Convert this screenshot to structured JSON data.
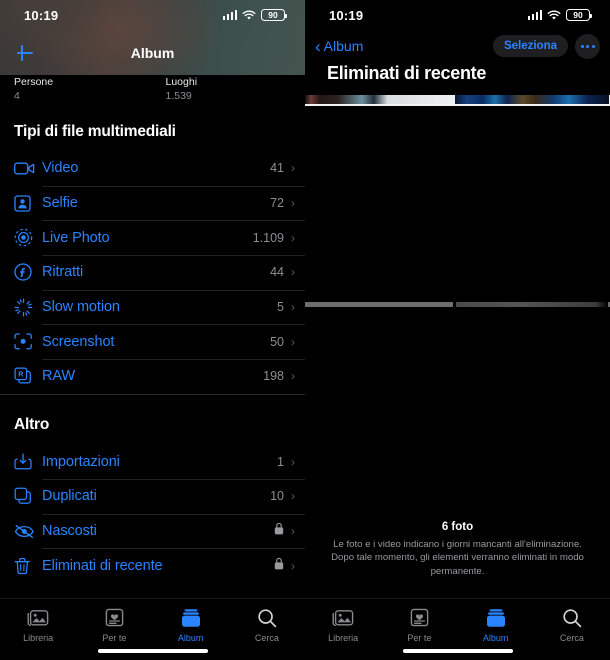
{
  "status_bar": {
    "time": "10:19",
    "battery": "90",
    "signal_icon": "cellular-bars-icon",
    "wifi_icon": "wifi-icon",
    "battery_icon": "battery-icon"
  },
  "left": {
    "nav": {
      "add_icon": "plus-icon",
      "title": "Album"
    },
    "quick": [
      {
        "name": "Persone",
        "count": "4"
      },
      {
        "name": "Luoghi",
        "count": "1.539"
      }
    ],
    "sections": [
      {
        "title": "Tipi di file multimediali",
        "rows": [
          {
            "icon": "video-camera-icon",
            "label": "Video",
            "count": "41",
            "chevron": "›"
          },
          {
            "icon": "person-portrait-icon",
            "label": "Selfie",
            "count": "72",
            "chevron": "›"
          },
          {
            "icon": "live-photo-icon",
            "label": "Live Photo",
            "count": "1.109",
            "chevron": "›"
          },
          {
            "icon": "portrait-f-icon",
            "label": "Ritratti",
            "count": "44",
            "chevron": "›"
          },
          {
            "icon": "slow-motion-icon",
            "label": "Slow motion",
            "count": "5",
            "chevron": "›"
          },
          {
            "icon": "screenshot-icon",
            "label": "Screenshot",
            "count": "50",
            "chevron": "›"
          },
          {
            "icon": "raw-icon",
            "label": "RAW",
            "count": "198",
            "chevron": "›"
          }
        ]
      },
      {
        "title": "Altro",
        "rows": [
          {
            "icon": "import-icon",
            "label": "Importazioni",
            "count": "1",
            "chevron": "›"
          },
          {
            "icon": "duplicate-icon",
            "label": "Duplicati",
            "count": "10",
            "chevron": "›"
          },
          {
            "icon": "eye-slash-icon",
            "label": "Nascosti",
            "count": "",
            "locked": true,
            "chevron": "›"
          },
          {
            "icon": "trash-icon",
            "label": "Eliminati di recente",
            "count": "",
            "locked": true,
            "chevron": "›"
          }
        ]
      }
    ]
  },
  "right": {
    "nav": {
      "back_label": "Album",
      "select_label": "Seleziona",
      "more_icon": "ellipsis-icon"
    },
    "title": "Eliminati di recente",
    "footer": {
      "count": "6 foto",
      "description": "Le foto e i video indicano i giorni mancanti all'eliminazione. Dopo tale momento, gli elementi verranno eliminati in modo permanente."
    }
  },
  "tabbar": {
    "items": [
      {
        "icon": "photo-library-icon",
        "label": "Libreria",
        "active": false
      },
      {
        "icon": "for-you-icon",
        "label": "Per te",
        "active": false
      },
      {
        "icon": "albums-icon",
        "label": "Album",
        "active": true
      },
      {
        "icon": "search-icon",
        "label": "Cerca",
        "active": false
      }
    ]
  },
  "colors": {
    "accent": "#2a84ff",
    "secondary_text": "#8e8e93",
    "background": "#000000"
  }
}
